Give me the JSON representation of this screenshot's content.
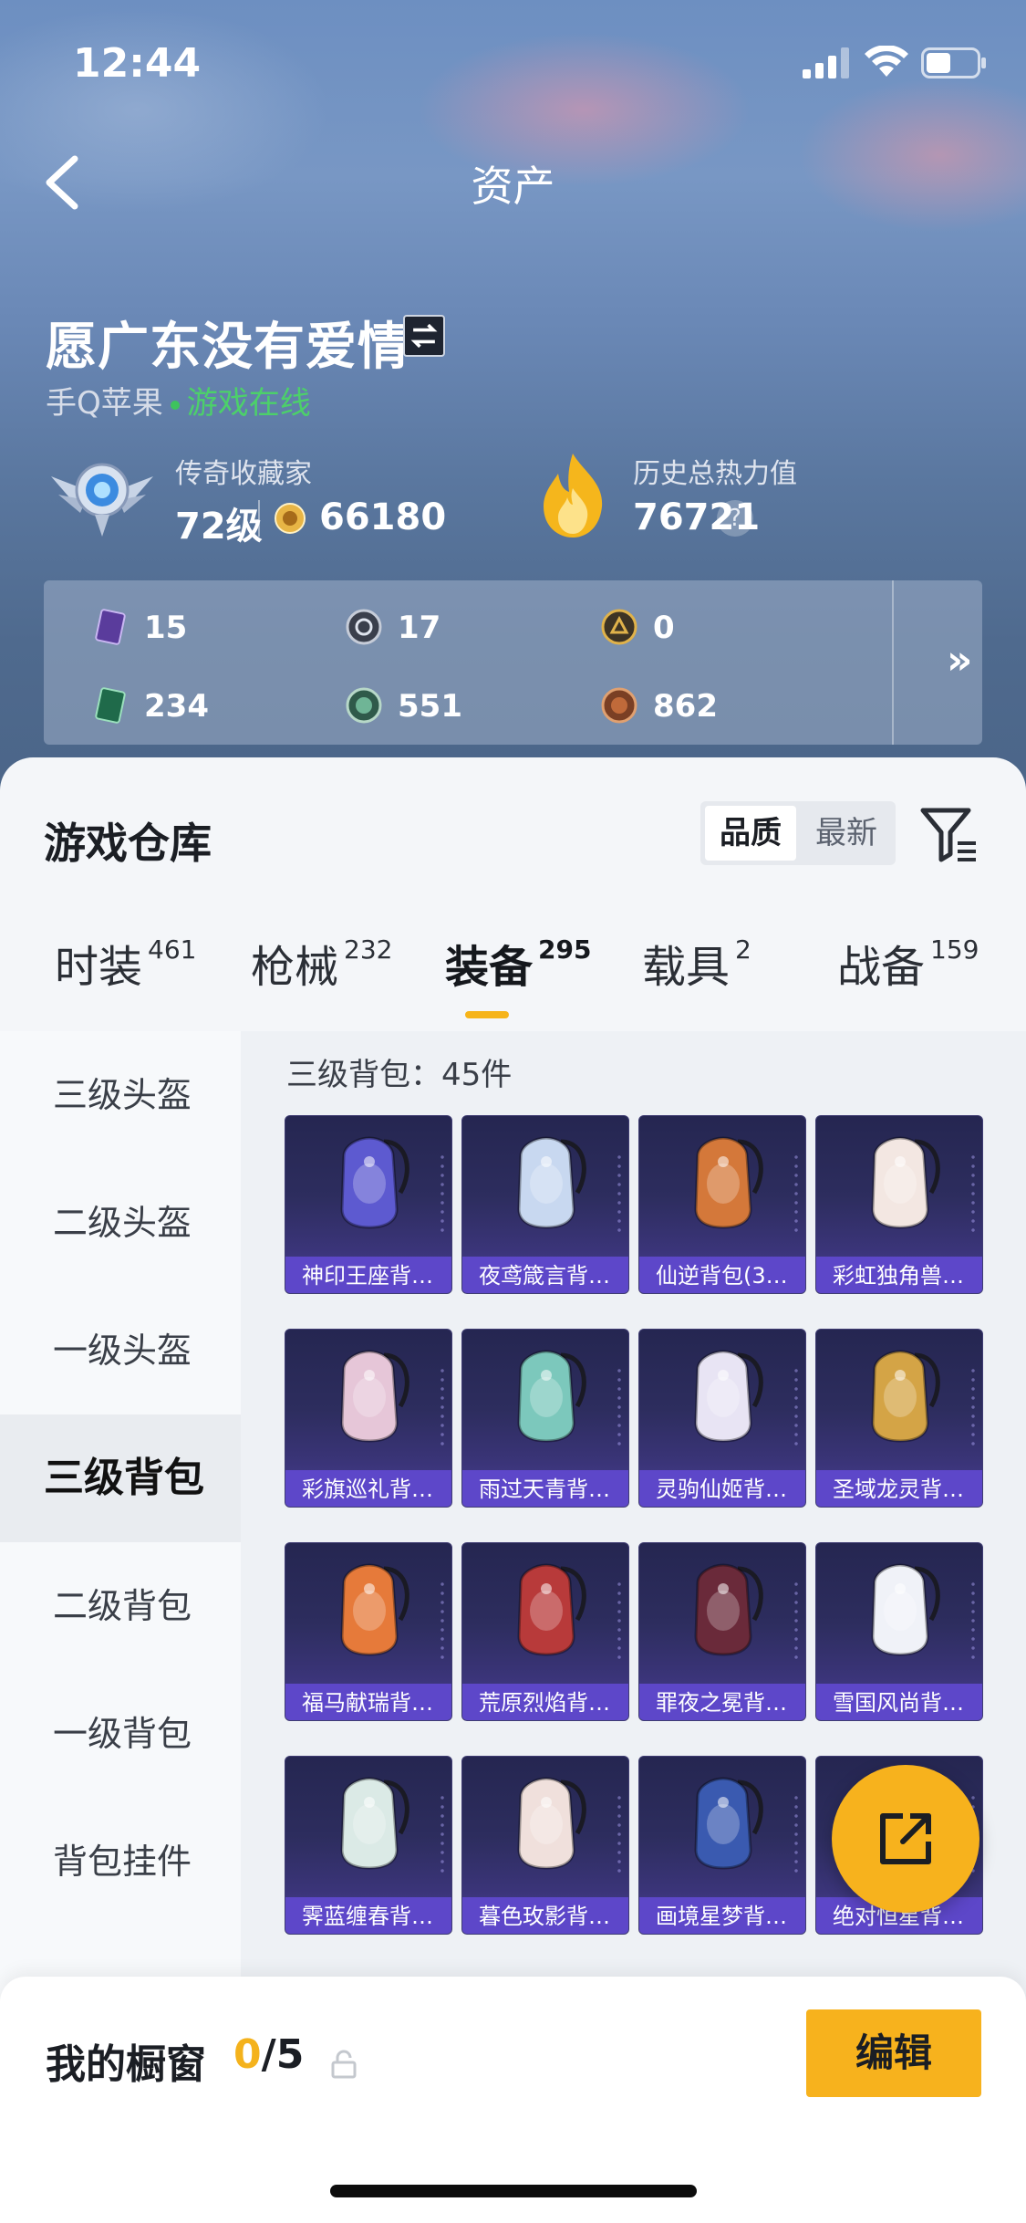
{
  "status_bar": {
    "time": "12:44"
  },
  "header": {
    "title": "资产",
    "username": "愿广东没有爱情",
    "platform": "手Q苹果",
    "online_status": "游戏在线"
  },
  "stats": {
    "rank_title": "传奇收藏家",
    "rank_level": "72级",
    "coins": "66180",
    "heat_title": "历史总热力值",
    "heat_value": "76721",
    "help_glyph": "?"
  },
  "counts": [
    {
      "icon": "purple-card-icon",
      "value": "15"
    },
    {
      "icon": "silver-badge-icon",
      "value": "17"
    },
    {
      "icon": "gold-badge-icon",
      "value": "0"
    },
    {
      "icon": "green-card-icon",
      "value": "234"
    },
    {
      "icon": "green-coin-icon",
      "value": "551"
    },
    {
      "icon": "bronze-coin-icon",
      "value": "862"
    }
  ],
  "counts_more": "»",
  "warehouse": {
    "title": "游戏仓库",
    "sort_options": [
      "品质",
      "最新"
    ],
    "sort_active": "品质"
  },
  "tabs": [
    {
      "label": "时装",
      "count": "461"
    },
    {
      "label": "枪械",
      "count": "232"
    },
    {
      "label": "装备",
      "count": "295"
    },
    {
      "label": "载具",
      "count": "2"
    },
    {
      "label": "战备",
      "count": "159"
    }
  ],
  "active_tab": "装备",
  "sidebar": [
    "三级头盔",
    "二级头盔",
    "一级头盔",
    "三级背包",
    "二级背包",
    "一级背包",
    "背包挂件"
  ],
  "sidebar_active": "三级背包",
  "content_label": "三级背包：45件",
  "items": [
    {
      "name": "神印王座背…",
      "color": "#5d5ad0"
    },
    {
      "name": "夜鸢箴言背…",
      "color": "#c8d8f0"
    },
    {
      "name": "仙逆背包(3…",
      "color": "#d4783a"
    },
    {
      "name": "彩虹独角兽…",
      "color": "#f3e7e2"
    },
    {
      "name": "彩旗巡礼背…",
      "color": "#e6c6d8"
    },
    {
      "name": "雨过天青背…",
      "color": "#7cc8bc"
    },
    {
      "name": "灵驹仙姬背…",
      "color": "#e8e4f4"
    },
    {
      "name": "圣域龙灵背…",
      "color": "#d4a446"
    },
    {
      "name": "福马献瑞背…",
      "color": "#e67a3a"
    },
    {
      "name": "荒原烈焰背…",
      "color": "#b83a3a"
    },
    {
      "name": "罪夜之冕背…",
      "color": "#6a2a3a"
    },
    {
      "name": "雪国风尚背…",
      "color": "#f0f2f8"
    },
    {
      "name": "霁蓝缠春背…",
      "color": "#dbeae6"
    },
    {
      "name": "暮色玫影背…",
      "color": "#f0e0dc"
    },
    {
      "name": "画境星梦背…",
      "color": "#3a5ab0"
    },
    {
      "name": "绝对恒星背…",
      "color": "#f0c040"
    }
  ],
  "showcase": {
    "label": "我的橱窗",
    "current": "0",
    "total": "/5",
    "edit_label": "编辑"
  },
  "colors": {
    "accent": "#f7b21d",
    "card_label_bg": "#5d47c9",
    "online": "#4cd06a"
  }
}
